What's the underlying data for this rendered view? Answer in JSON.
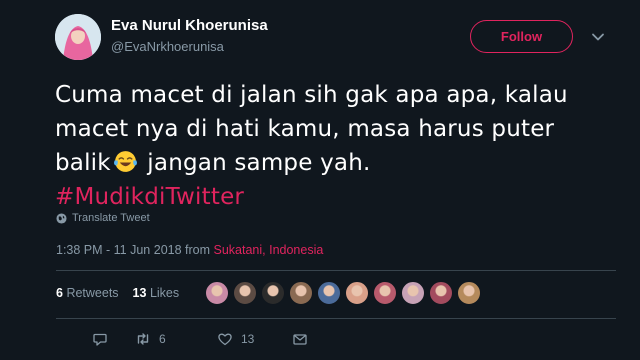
{
  "author": {
    "name": "Eva Nurul Khoerunisa",
    "handle": "@EvaNrkhoerunisa"
  },
  "follow_label": "Follow",
  "tweet": {
    "line1": "Cuma macet di jalan sih gak apa apa, kalau",
    "line2": "macet nya di hati kamu, masa harus puter",
    "line3_before": "balik",
    "line3_after": " jangan sampe yah.",
    "hashtag": "#MudikdiTwitter"
  },
  "translate_label": "Translate Tweet",
  "timestamp": "1:38 PM - 11 Jun 2018 from ",
  "location": "Sukatani, Indonesia",
  "stats": {
    "retweets_count": "6",
    "retweets_label": "Retweets",
    "likes_count": "13",
    "likes_label": "Likes"
  },
  "liker_avatars": [
    {
      "color": "#c98aa6"
    },
    {
      "color": "#5c4b43"
    },
    {
      "color": "#2b2b2b"
    },
    {
      "color": "#8a6a52"
    },
    {
      "color": "#4b6b9a"
    },
    {
      "color": "#d9a089"
    },
    {
      "color": "#b85a6c"
    },
    {
      "color": "#c7a2b6"
    },
    {
      "color": "#a34b5e"
    },
    {
      "color": "#b58a5c"
    }
  ],
  "actions": {
    "retweet_count": "6",
    "like_count": "13"
  },
  "colors": {
    "accent": "#e0245e",
    "muted": "#8899a6",
    "background": "#10171e",
    "divider": "#38444d"
  },
  "icons": {
    "more": "chevron-down-icon",
    "translate": "globe-icon",
    "reply": "reply-icon",
    "retweet": "retweet-icon",
    "like": "heart-icon",
    "dm": "mail-icon",
    "emoji": "tears-of-joy-emoji"
  }
}
